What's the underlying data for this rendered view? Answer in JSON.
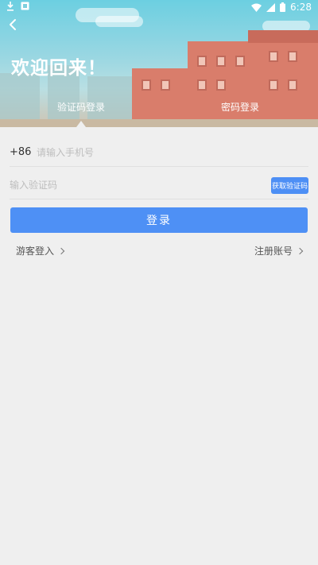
{
  "status_bar": {
    "time": "6:28"
  },
  "header": {
    "welcome": "欢迎回来！",
    "tabs": [
      {
        "label": "验证码登录",
        "active": true
      },
      {
        "label": "密码登录",
        "active": false
      }
    ]
  },
  "form": {
    "country_code": "+86",
    "phone_placeholder": "请输入手机号",
    "code_placeholder": "输入验证码",
    "get_code_label": "获取验证码",
    "login_label": "登录"
  },
  "links": {
    "guest": "游客登入",
    "register": "注册账号"
  },
  "colors": {
    "accent": "#4e90f5",
    "background": "#efefef"
  }
}
